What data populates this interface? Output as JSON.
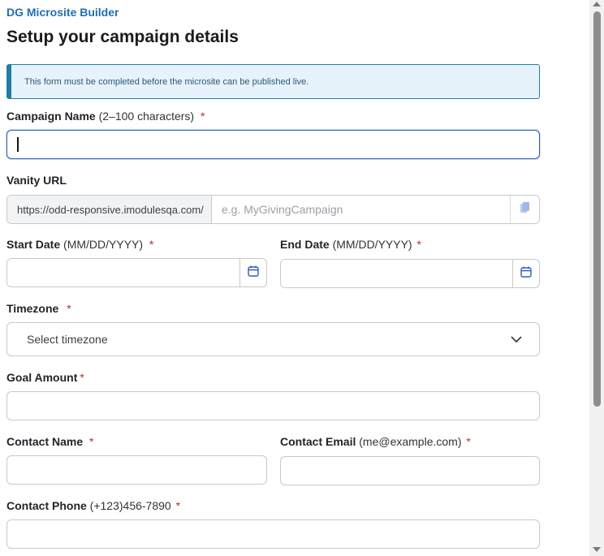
{
  "app": {
    "title": "DG Microsite Builder"
  },
  "page": {
    "title": "Setup your campaign details"
  },
  "notice": {
    "text": "This form must be completed before the microsite can be published live."
  },
  "fields": {
    "campaign_name": {
      "label": "Campaign Name",
      "hint": "(2–100 characters)",
      "required": "*",
      "value": ""
    },
    "vanity_url": {
      "label": "Vanity URL",
      "prefix": "https://odd-responsive.imodulesqa.com/",
      "placeholder": "e.g. MyGivingCampaign",
      "copy_icon": "copy-icon"
    },
    "start_date": {
      "label": "Start Date",
      "hint": "(MM/DD/YYYY)",
      "required": "*",
      "icon": "calendar-icon"
    },
    "end_date": {
      "label": "End Date",
      "hint": "(MM/DD/YYYY)",
      "required": "*",
      "icon": "calendar-icon"
    },
    "timezone": {
      "label": "Timezone",
      "required": "*",
      "selected": "Select timezone",
      "icon": "chevron-down-icon"
    },
    "goal_amount": {
      "label": "Goal Amount",
      "required": "*"
    },
    "contact_name": {
      "label": "Contact Name",
      "required": "*"
    },
    "contact_email": {
      "label": "Contact Email",
      "hint": "(me@example.com)",
      "required": "*"
    },
    "contact_phone": {
      "label": "Contact Phone",
      "hint": "(+123)456-7890",
      "required": "*"
    }
  },
  "colors": {
    "brand": "#1f6fb5",
    "notice_border": "#1f7fa8",
    "notice_bg": "#e6f3fa",
    "required": "#c62828",
    "focus": "#2b5fbf",
    "icon": "#2b5fbf"
  }
}
